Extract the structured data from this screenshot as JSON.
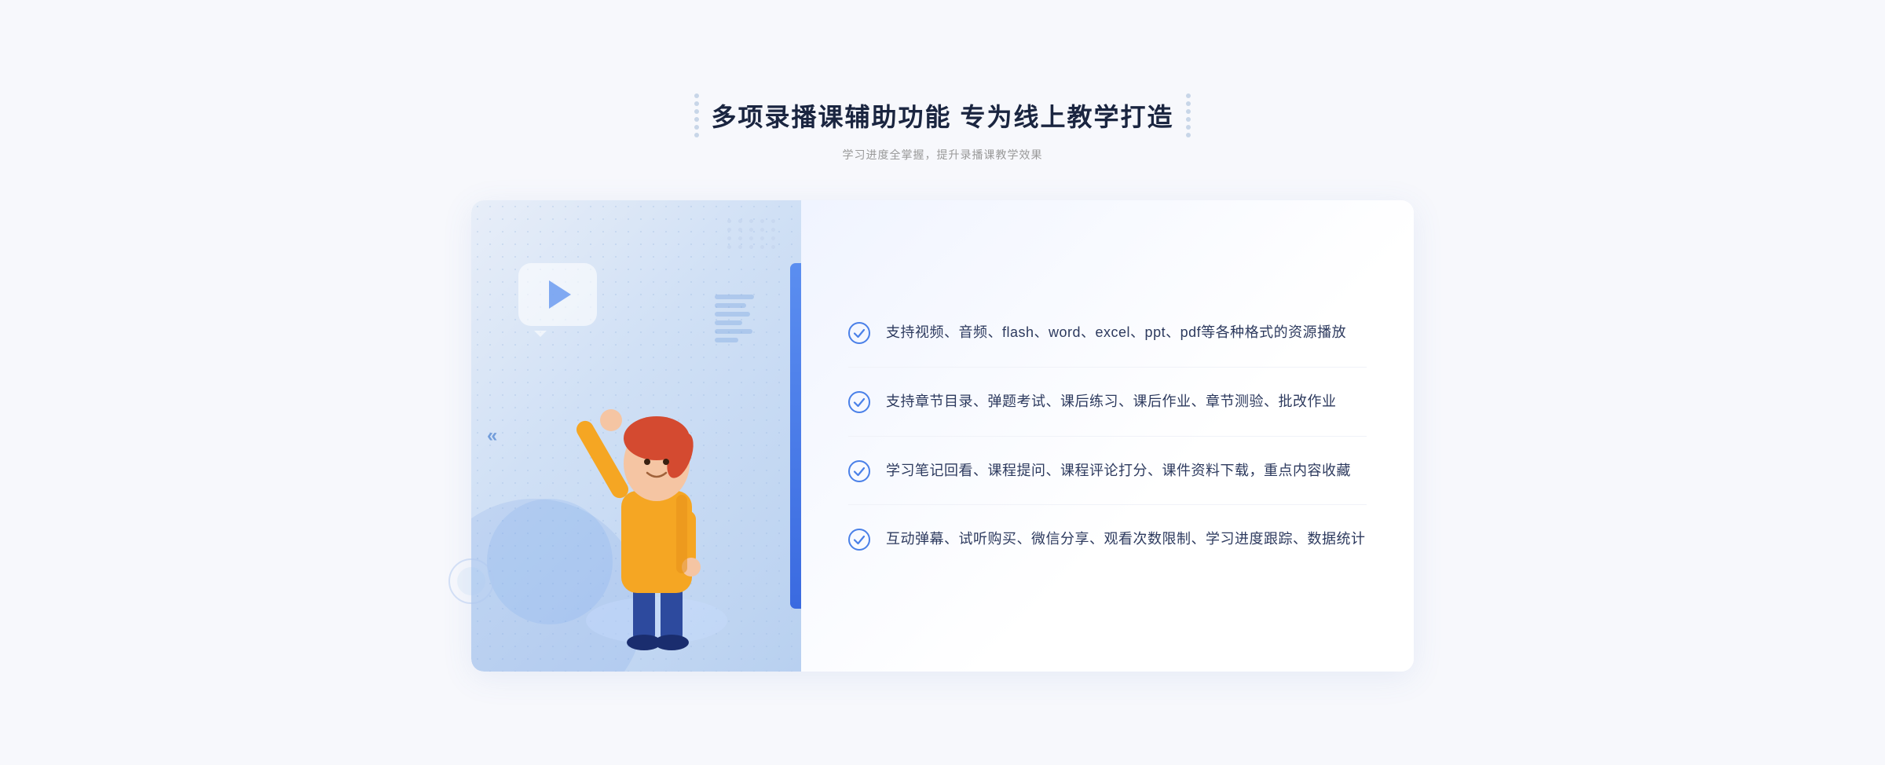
{
  "header": {
    "title": "多项录播课辅助功能 专为线上教学打造",
    "subtitle": "学习进度全掌握，提升录播课教学效果",
    "dots_left_aria": "decorative dots left",
    "dots_right_aria": "decorative dots right"
  },
  "features": [
    {
      "id": 1,
      "text": "支持视频、音频、flash、word、excel、ppt、pdf等各种格式的资源播放"
    },
    {
      "id": 2,
      "text": "支持章节目录、弹题考试、课后练习、课后作业、章节测验、批改作业"
    },
    {
      "id": 3,
      "text": "学习笔记回看、课程提问、课程评论打分、课件资料下载，重点内容收藏"
    },
    {
      "id": 4,
      "text": "互动弹幕、试听购买、微信分享、观看次数限制、学习进度跟踪、数据统计"
    }
  ],
  "illustration": {
    "play_button_aria": "play button",
    "chevron_aria": "left arrow",
    "blue_bar_aria": "decorative blue bar"
  }
}
